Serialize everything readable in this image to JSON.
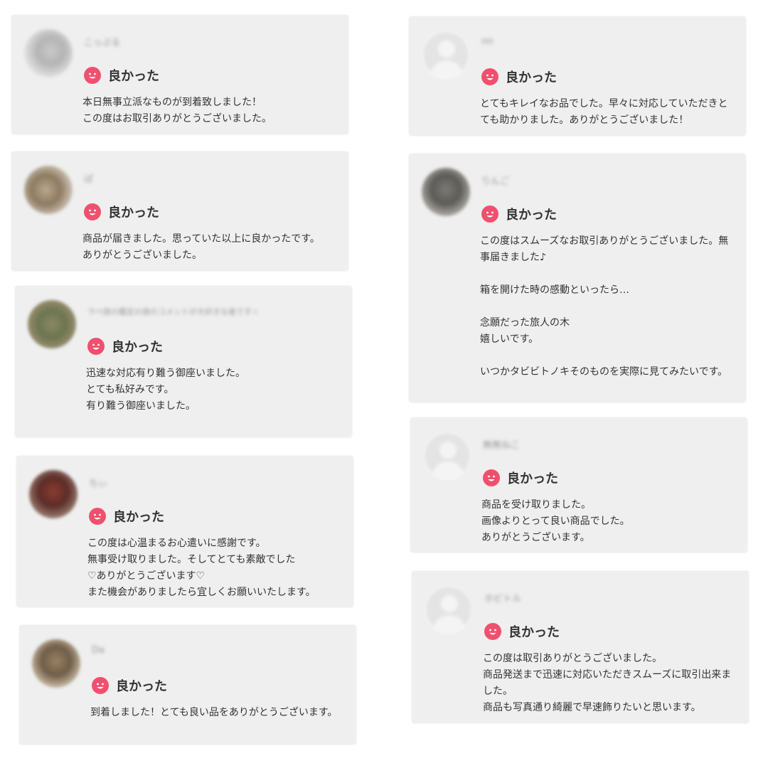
{
  "rating_label": "良かった",
  "colors": {
    "card_bg": "#efefef",
    "accent_face": "#f0506e"
  },
  "reviews": [
    {
      "username": "こっぷる",
      "comment": "本日無事立派なものが到着致しました！\nこの度はお取引ありがとうございました。"
    },
    {
      "username": "ぱ",
      "comment": "商品が届きました。思っていた以上に良かったです。ありがとうございました。"
    },
    {
      "username": "ラベ旅の鑑定の旅のコメントが大好きな者です☆",
      "comment": "迅速な対応有り難う御座いました。\nとても私好みです。\n有り難う御座いました。"
    },
    {
      "username": "ちぃ",
      "comment": "この度は心温まるお心遣いに感謝です。\n無事受け取りました。そしてとても素敵でした\n♡ありがとうございます♡\nまた機会がありましたら宜しくお願いいたします。"
    },
    {
      "username": "Da",
      "comment": "到着しました！とても良い品をありがとうございます。"
    },
    {
      "username": "nn",
      "comment": "とてもキレイなお品でした。早々に対応していただきとても助かりました。ありがとうございました！"
    },
    {
      "username": "りんご",
      "comment": "この度はスムーズなお取引ありがとうございました。無事届きました♪\n\n箱を開けた時の感動といったら…\n\n念願だった旅人の木\n嬉しいです。\n\nいつかタビビトノキそのものを実際に見てみたいです。"
    },
    {
      "username": "無無ねこ",
      "comment": "商品を受け取りました。\n画像よりとって良い商品でした。\nありがとうございます。"
    },
    {
      "username": "ホビトル",
      "comment": "この度は取引ありがとうございました。\n商品発送まで迅速に対応いただきスムーズに取引出来ました。\n商品も写真通り綺麗で早速飾りたいと思います。"
    }
  ]
}
